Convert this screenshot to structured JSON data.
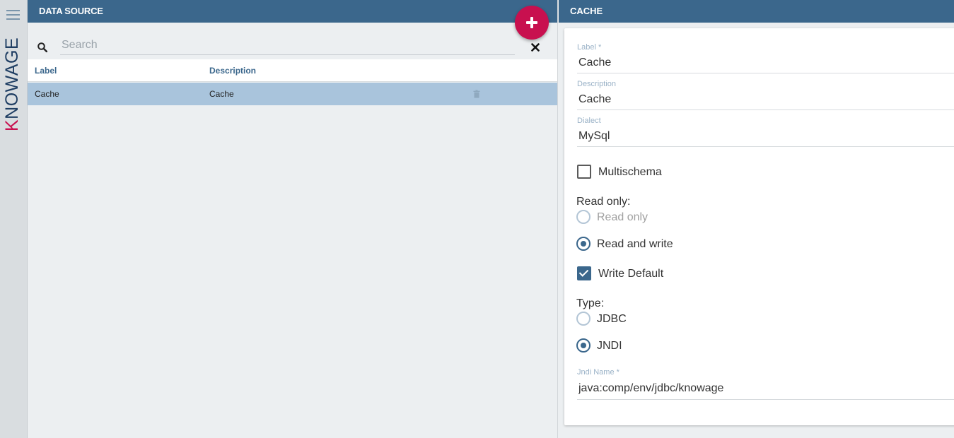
{
  "app": {
    "logo_text": "KNOWAGE"
  },
  "colors": {
    "header": "#3b678c",
    "accent": "#c8104f",
    "selected_row": "#a9c4dc"
  },
  "left_panel": {
    "title": "DATA SOURCE",
    "search": {
      "placeholder": "Search",
      "value": ""
    },
    "columns": [
      "Label",
      "Description"
    ],
    "rows": [
      {
        "label": "Cache",
        "description": "Cache"
      }
    ]
  },
  "right_panel": {
    "title": "CACHE",
    "label_field": {
      "label": "Label *",
      "value": "Cache"
    },
    "description_field": {
      "label": "Description",
      "value": "Cache"
    },
    "dialect_field": {
      "label": "Dialect",
      "value": "MySql"
    },
    "multischema": {
      "label": "Multischema",
      "checked": false
    },
    "read_only": {
      "title": "Read only:",
      "options": [
        {
          "label": "Read only",
          "selected": false,
          "disabled": true
        },
        {
          "label": "Read and write",
          "selected": true
        }
      ]
    },
    "write_default": {
      "label": "Write Default",
      "checked": true
    },
    "type": {
      "title": "Type:",
      "options": [
        {
          "label": "JDBC",
          "selected": false
        },
        {
          "label": "JNDI",
          "selected": true
        }
      ]
    },
    "jndi_field": {
      "label": "Jndi Name *",
      "value": "java:comp/env/jdbc/knowage"
    }
  }
}
